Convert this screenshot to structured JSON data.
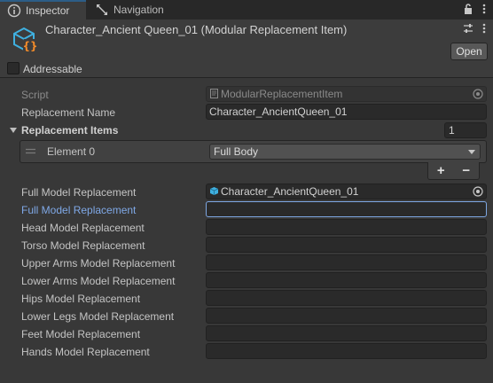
{
  "tabs": [
    {
      "label": "Inspector",
      "icon": "info-icon",
      "active": true
    },
    {
      "label": "Navigation",
      "icon": "navigation-icon",
      "active": false
    }
  ],
  "header": {
    "title": "Character_Ancient Queen_01 (Modular Replacement Item)",
    "open_label": "Open",
    "addressable_label": "Addressable",
    "addressable_checked": false
  },
  "properties": {
    "script_label": "Script",
    "script_value": "ModularReplacementItem",
    "replacement_name_label": "Replacement Name",
    "replacement_name_value": "Character_AncientQueen_01",
    "replacement_items_label": "Replacement Items",
    "replacement_items_count": "1",
    "element_label": "Element 0",
    "element_value": "Full Body",
    "add_label": "+",
    "remove_label": "−"
  },
  "models": [
    {
      "label": "Full Model Replacement",
      "value": "Character_AncientQueen_01",
      "has_object": true
    },
    {
      "label": "Full Model Replacement",
      "value": "",
      "focused": true
    },
    {
      "label": "Head Model Replacement",
      "value": ""
    },
    {
      "label": "Torso Model Replacement",
      "value": ""
    },
    {
      "label": "Upper Arms Model Replacement",
      "value": ""
    },
    {
      "label": "Lower Arms Model Replacement",
      "value": ""
    },
    {
      "label": "Hips Model Replacement",
      "value": ""
    },
    {
      "label": "Lower Legs Model Replacement",
      "value": ""
    },
    {
      "label": "Feet Model Replacement",
      "value": ""
    },
    {
      "label": "Hands Model Replacement",
      "value": ""
    }
  ],
  "colors": {
    "accent": "#2c5d87",
    "focus": "#7ea7e3",
    "icon_blue": "#3fb0e0",
    "icon_orange": "#f08a2a"
  }
}
